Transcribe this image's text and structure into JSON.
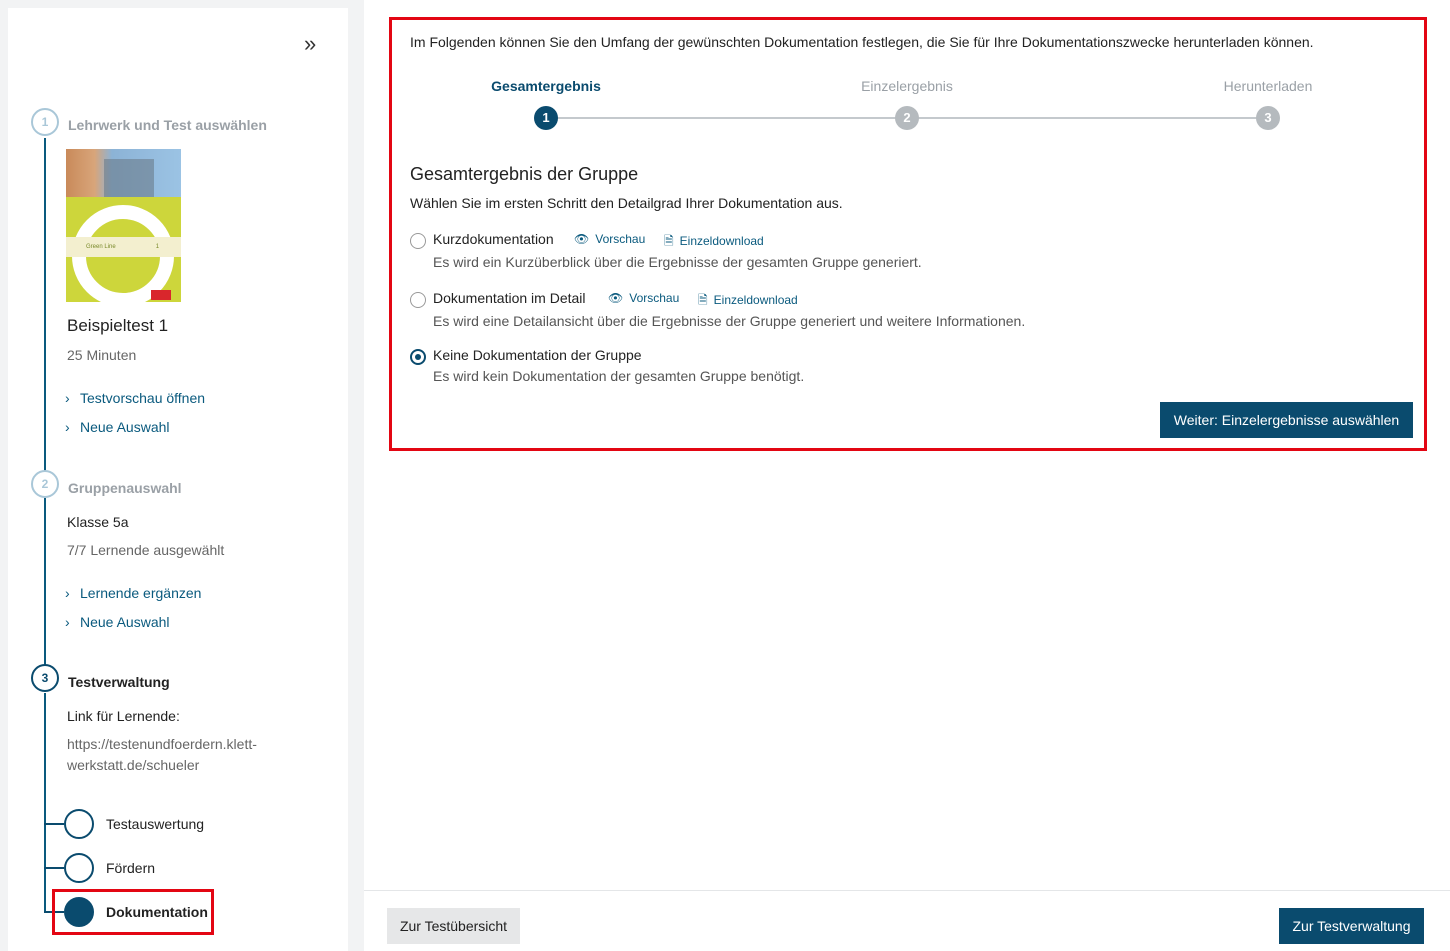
{
  "sidebar": {
    "collapse_icon": "double-chevron-right-icon",
    "step1": {
      "number": "1",
      "title": "Lehrwerk und Test auswählen"
    },
    "book": {
      "series_label": "Green Line",
      "volume": "1"
    },
    "test": {
      "name": "Beispieltest 1",
      "duration": "25 Minuten"
    },
    "step1_links": [
      "Testvorschau öffnen",
      "Neue Auswahl"
    ],
    "step2": {
      "number": "2",
      "title": "Gruppenauswahl"
    },
    "group": {
      "name": "Klasse 5a",
      "selected": "7/7 Lernende ausgewählt"
    },
    "step2_links": [
      "Lernende ergänzen",
      "Neue Auswahl"
    ],
    "step3": {
      "number": "3",
      "title": "Testverwaltung"
    },
    "link_label": "Link für Lernende:",
    "link_url_line1": "https://testenundfoerdern.klett-",
    "link_url_line2": "werkstatt.de/schueler",
    "substeps": [
      "Testauswertung",
      "Fördern",
      "Dokumentation"
    ]
  },
  "main": {
    "intro": "Im Folgenden können Sie den Umfang der gewünschten Dokumentation festlegen, die Sie für Ihre Dokumentationszwecke herunterladen können.",
    "stepper": [
      {
        "label": "Gesamtergebnis",
        "number": "1",
        "active": true
      },
      {
        "label": "Einzelergebnis",
        "number": "2",
        "active": false
      },
      {
        "label": "Herunterladen",
        "number": "3",
        "active": false
      }
    ],
    "heading": "Gesamtergebnis der Gruppe",
    "lead": "Wählen Sie im ersten Schritt den Detailgrad Ihrer Dokumentation aus.",
    "options": [
      {
        "label": "Kurzdokumentation",
        "preview": "Vorschau",
        "download": "Einzeldownload",
        "description": "Es wird ein Kurzüberblick über die Ergebnisse der gesamten Gruppe generiert.",
        "checked": false
      },
      {
        "label": "Dokumentation im Detail",
        "preview": "Vorschau",
        "download": "Einzeldownload",
        "description": "Es wird eine Detailansicht über die Ergebnisse der Gruppe generiert und weitere Informationen.",
        "checked": false
      },
      {
        "label": "Keine Dokumentation der Gruppe",
        "description": "Es wird kein Dokumentation der gesamten Gruppe benötigt.",
        "checked": true
      }
    ],
    "next_button": "Weiter: Einzelergebnisse auswählen"
  },
  "footer": {
    "back_button": "Zur Testübersicht",
    "forward_button": "Zur Testverwaltung"
  },
  "colors": {
    "primary": "#0a4b6e",
    "highlight": "#e30613",
    "muted": "#9aa0a6"
  }
}
